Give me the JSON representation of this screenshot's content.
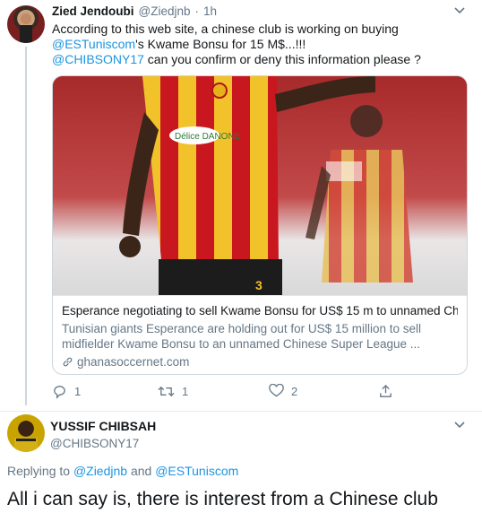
{
  "tweet1": {
    "author_name": "Zied Jendoubi",
    "author_handle": "@Ziedjnb",
    "separator": "·",
    "time": "1h",
    "text_line1": "According to this web site, a chinese club is working on buying",
    "mention1": "@ESTuniscom",
    "text_line2_rest": "'s Kwame Bonsu for 15 M$...!!!",
    "mention2": "@CHIBSONY17",
    "text_line3_rest": " can you confirm or deny this information please ?",
    "card": {
      "title": "Esperance negotiating to sell Kwame Bonsu for US$ 15 m to unnamed Ch...",
      "description": "Tunisian giants Esperance are holding out for US$ 15 million to sell midfielder Kwame Bonsu to an unnamed Chinese Super League ...",
      "domain": "ghanasoccernet.com",
      "image_text": {
        "sponsor": "Délice DANONE",
        "shirt_number": "3"
      }
    },
    "actions": {
      "reply_count": "1",
      "retweet_count": "1",
      "like_count": "2"
    }
  },
  "tweet2": {
    "author_name": "YUSSIF CHIBSAH",
    "author_handle": "@CHIBSONY17",
    "replying_prefix": "Replying to ",
    "replying_mention1": "@Ziedjnb",
    "replying_and": " and ",
    "replying_mention2": "@ESTuniscom",
    "text": "All i can say is, there is interest from a Chinese club"
  },
  "colors": {
    "link": "#1b95e0",
    "secondary": "#657786",
    "border": "#ccd6dd",
    "jersey_red": "#c8171e",
    "jersey_yellow": "#f2c22a"
  }
}
